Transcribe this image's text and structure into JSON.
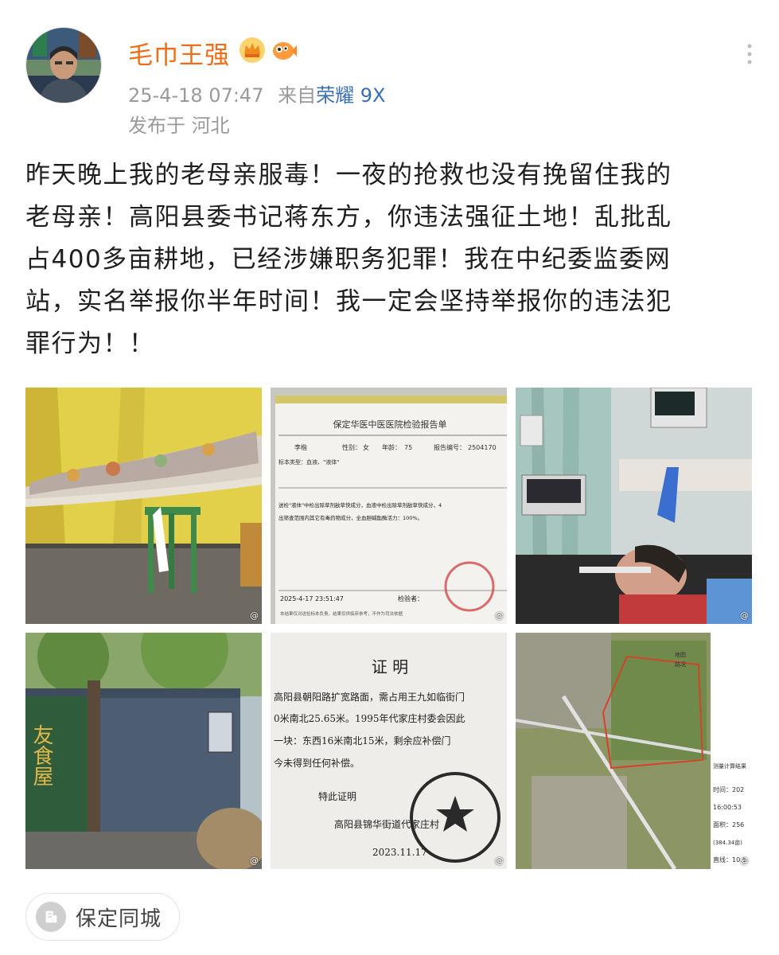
{
  "post": {
    "username": "毛巾王强",
    "timestamp": "25-4-18 07:47",
    "source_prefix": "来自",
    "device": "荣耀 9X",
    "location": "发布于 河北",
    "text_lines": [
      "昨天晚上我的老母亲服毒！一夜的抢救也没有挽留住我的",
      "老母亲！高阳县委书记蒋东方，你违法强征土地！乱批乱",
      "占400多亩耕地，已经涉嫌职务犯罪！我在中纪委监委网",
      "站，实名举报你半年时间！我一定会坚持举报你的违法犯",
      "罪行为！！"
    ],
    "badges": [
      "crown-icon",
      "fish-icon"
    ],
    "more_icon": "more-vertical-icon"
  },
  "images": {
    "report": {
      "title": "保定华医中医医院检验报告单",
      "name": "李楷",
      "gender_label": "性别：",
      "gender": "女",
      "age_label": "年龄：",
      "age": "75",
      "report_no_label": "报告编号：",
      "report_no": "2504170",
      "sample_type": "标本类型：血液、\"液体\"",
      "line1": "送检\"液体\"中检出除草剂敌草快成分，血液中检出除草剂敌草快成分，4",
      "line2": "出筛查范围内其它有毒药物成分，全血胆碱酯酶活力：100%。",
      "datetime": "2025-4-17 23:51:47",
      "examiner_label": "检验者：",
      "footer_note": "本结果仅对送检标本负责，结果仅供临床参考，不作为司法依据"
    },
    "certificate": {
      "title": "证    明",
      "line1": "高阳县朝阳路扩宽路面，需占用王九如临街门",
      "line2": "0米南北25.65米。1995年代家庄村委会因此",
      "line3": "一块：东西16米南北15米，剩余应补偿门",
      "line4": "今未得到任何补偿。",
      "closing": "特此证明",
      "issuer": "高阳县锦华街道代家庄村",
      "date": "2023.11.17",
      "seal_text": "高阳县锦华街道代家庄村"
    },
    "shack_sign": "友食屋",
    "map_panel": {
      "label1": "地图",
      "label2": "路况",
      "result_title": "测量计算结果",
      "time_label": "时间：202",
      "time_value": "16:00:53",
      "area_label": "面积：256",
      "mu": "(384.34亩)",
      "line_label": "直线：10.5"
    },
    "watermark": "@"
  },
  "topic_tag": {
    "label": "保定同城",
    "icon": "building-icon"
  }
}
